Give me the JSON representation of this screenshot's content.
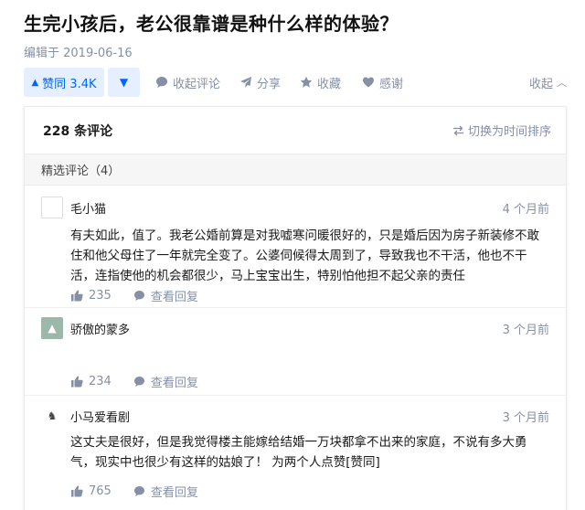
{
  "question": {
    "title": "生完小孩后，老公很靠谱是种什么样的体验？",
    "edit_date": "编辑于 2019-06-16"
  },
  "actions": {
    "vote_up_label": "赞同 3.4K",
    "collapse_comment_label": "收起评论",
    "share_label": "分享",
    "favorite_label": "收藏",
    "thanks_label": "感谢",
    "collapse_label": "收起"
  },
  "comments_panel": {
    "count_label": "228 条评论",
    "sort_label": "切换为时间排序",
    "featured_label": "精选评论（4）",
    "items": [
      {
        "author": "毛小猫",
        "time": "4 个月前",
        "lines": [
          "有夫如此，值了。我老公婚前算是对我嘘寒问暖很好的，只是婚后因为房子新装修不敢",
          "住和他父母住了一年就完全变了。公婆伺候得太周到了，导致我也不干活，他也不干",
          "活，连指使他的机会都很少，马上宝宝出生，特别怕他担不起父亲的责任"
        ],
        "likes": "235",
        "reply_label": "查看回复"
      },
      {
        "author": "骄傲的蒙多",
        "time": "3 个月前",
        "lines": [],
        "likes": "234",
        "reply_label": "查看回复"
      },
      {
        "author": "小马爱看剧",
        "time": "3 个月前",
        "lines": [
          "这丈夫是很好，但是我觉得楼主能嫁给结婚一万块都拿不出来的家庭，不说有多大勇",
          "气，现实中也很少有这样的姑娘了！ 为两个人点赞[赞同]"
        ],
        "likes": "765",
        "reply_label": "查看回复"
      }
    ]
  },
  "colors": {
    "accent": "#0066ff",
    "accent_bg": "#e5efff",
    "muted": "#8590a6"
  }
}
